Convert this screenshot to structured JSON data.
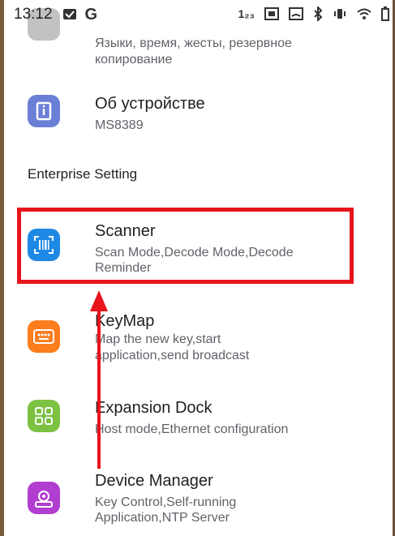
{
  "status_bar": {
    "time": "13:12",
    "g_label": "G",
    "data_label": "1₂₃"
  },
  "top_partial": {
    "subtitle_line1": "Языки, время, жесты, резервное",
    "subtitle_line2": "копирование"
  },
  "about": {
    "title": "Об устройстве",
    "subtitle": "MS8389",
    "icon": "info-icon",
    "color": "#6b7fd7"
  },
  "section_header": "Enterprise Setting",
  "scanner": {
    "title": "Scanner",
    "subtitle_line1": "Scan Mode,Decode Mode,Decode",
    "subtitle_line2": "Reminder",
    "icon": "barcode-scanner-icon",
    "color": "#1e88e5"
  },
  "keymap": {
    "title": "KeyMap",
    "subtitle_line1": "Map the new key,start",
    "subtitle_line2": "application,send broadcast",
    "icon": "keyboard-icon",
    "color": "#fb7d1e"
  },
  "dock": {
    "title": "Expansion Dock",
    "subtitle": "Host mode,Ethernet configuration",
    "icon": "grid-icon",
    "color": "#7cc142"
  },
  "device_manager": {
    "title": "Device Manager",
    "subtitle_line1": "Key Control,Self-running",
    "subtitle_line2": "Application,NTP Server",
    "icon": "device-settings-icon",
    "color": "#b23ed1"
  },
  "annotation_color": "#e8141b"
}
